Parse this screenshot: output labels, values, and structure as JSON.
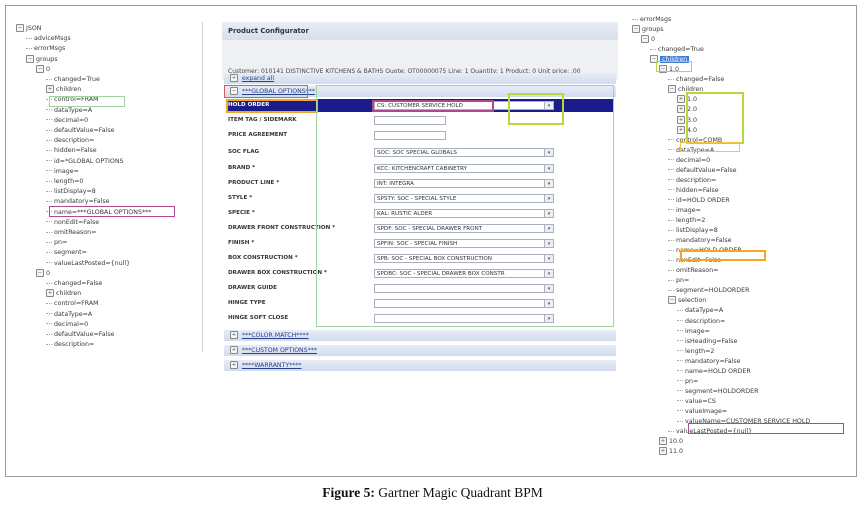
{
  "left_tree": [
    {
      "text": "JSON",
      "indent": 0,
      "toggle": "⊖"
    },
    {
      "text": "adviceMsgs",
      "indent": 1
    },
    {
      "text": "errorMsgs",
      "indent": 1
    },
    {
      "text": "groups",
      "indent": 1,
      "toggle": "⊖"
    },
    {
      "text": "0",
      "indent": 2,
      "toggle": "⊖"
    },
    {
      "text": "changed=True",
      "indent": 3
    },
    {
      "text": "children",
      "indent": 3,
      "toggle": "⊕"
    },
    {
      "text": "control=FRAM",
      "indent": 3
    },
    {
      "text": "dataType=A",
      "indent": 3
    },
    {
      "text": "decimal=0",
      "indent": 3
    },
    {
      "text": "defaultValue=False",
      "indent": 3
    },
    {
      "text": "description=",
      "indent": 3
    },
    {
      "text": "hidden=False",
      "indent": 3
    },
    {
      "text": "id=*GLOBAL OPTIONS",
      "indent": 3
    },
    {
      "text": "image=",
      "indent": 3
    },
    {
      "text": "length=0",
      "indent": 3
    },
    {
      "text": "listDisplay=8",
      "indent": 3
    },
    {
      "text": "mandatory=False",
      "indent": 3
    },
    {
      "text": "name=***GLOBAL OPTIONS***",
      "indent": 3
    },
    {
      "text": "nonEdit=False",
      "indent": 3
    },
    {
      "text": "omitReason=",
      "indent": 3
    },
    {
      "text": "pn=",
      "indent": 3
    },
    {
      "text": "segment=",
      "indent": 3
    },
    {
      "text": "valueLastPosted={null}",
      "indent": 3
    },
    {
      "text": "0",
      "indent": 2,
      "toggle": "⊖"
    },
    {
      "text": "changed=False",
      "indent": 3
    },
    {
      "text": "children",
      "indent": 3,
      "toggle": "⊕"
    },
    {
      "text": "control=FRAM",
      "indent": 3
    },
    {
      "text": "dataType=A",
      "indent": 3
    },
    {
      "text": "decimal=0",
      "indent": 3
    },
    {
      "text": "defaultValue=False",
      "indent": 3
    },
    {
      "text": "description=",
      "indent": 3
    }
  ],
  "right_tree": [
    {
      "text": "errorMsgs",
      "indent": 0
    },
    {
      "text": "groups",
      "indent": 0,
      "toggle": "⊖"
    },
    {
      "text": "0",
      "indent": 1,
      "toggle": "⊖"
    },
    {
      "text": "changed=True",
      "indent": 2
    },
    {
      "text": "children",
      "indent": 2,
      "toggle": "⊖",
      "selected": true
    },
    {
      "text": "1.0",
      "indent": 3,
      "toggle": "⊖"
    },
    {
      "text": "changed=False",
      "indent": 4
    },
    {
      "text": "children",
      "indent": 4,
      "toggle": "⊖"
    },
    {
      "text": "1.0",
      "indent": 5,
      "toggle": "⊕"
    },
    {
      "text": "2.0",
      "indent": 5,
      "toggle": "⊕"
    },
    {
      "text": "3.0",
      "indent": 5,
      "toggle": "⊕"
    },
    {
      "text": "4.0",
      "indent": 5,
      "toggle": "⊕"
    },
    {
      "text": "control=COMB",
      "indent": 4
    },
    {
      "text": "dataType=A",
      "indent": 4
    },
    {
      "text": "decimal=0",
      "indent": 4
    },
    {
      "text": "defaultValue=False",
      "indent": 4
    },
    {
      "text": "description=",
      "indent": 4
    },
    {
      "text": "hidden=False",
      "indent": 4
    },
    {
      "text": "id=HOLD ORDER",
      "indent": 4
    },
    {
      "text": "image=",
      "indent": 4
    },
    {
      "text": "length=2",
      "indent": 4
    },
    {
      "text": "listDisplay=8",
      "indent": 4
    },
    {
      "text": "mandatory=False",
      "indent": 4
    },
    {
      "text": "name=HOLD ORDER",
      "indent": 4
    },
    {
      "text": "nonEdit=False",
      "indent": 4
    },
    {
      "text": "omitReason=",
      "indent": 4
    },
    {
      "text": "pn=",
      "indent": 4
    },
    {
      "text": "segment=HOLDORDER",
      "indent": 4
    },
    {
      "text": "selection",
      "indent": 4,
      "toggle": "⊖"
    },
    {
      "text": "dataType=A",
      "indent": 5
    },
    {
      "text": "description=",
      "indent": 5
    },
    {
      "text": "image=",
      "indent": 5
    },
    {
      "text": "isHeading=False",
      "indent": 5
    },
    {
      "text": "length=2",
      "indent": 5
    },
    {
      "text": "mandatory=False",
      "indent": 5
    },
    {
      "text": "name=HOLD ORDER",
      "indent": 5
    },
    {
      "text": "pn=",
      "indent": 5
    },
    {
      "text": "segment=HOLDORDER",
      "indent": 5
    },
    {
      "text": "value=CS",
      "indent": 5
    },
    {
      "text": "valueImage=",
      "indent": 5
    },
    {
      "text": "valueName=CUSTOMER SERVICE HOLD",
      "indent": 5
    },
    {
      "text": "valueLastPosted={null}",
      "indent": 4
    },
    {
      "text": "10.0",
      "indent": 3,
      "toggle": "⊕"
    },
    {
      "text": "11.0",
      "indent": 3,
      "toggle": "⊕"
    }
  ],
  "configurator": {
    "title": "Product Configurator",
    "info": "Customer:  010141 DISTINCTIVE KITCHENS & BATHS   Quote:  QT00000075   Line:  1  Quantity:  1  Product:  0  Unit price:  .00",
    "expand_all": "expand all",
    "sections": {
      "global": "***GLOBAL OPTIONS***",
      "color": "***COLOR MATCH****",
      "custom": "***CUSTOM OPTIONS***",
      "warranty": "****WARRANTY****"
    },
    "fields": [
      {
        "label": "HOLD ORDER",
        "type": "select",
        "value": "CS: CUSTOMER SERVICE HOLD",
        "highlight": true
      },
      {
        "label": "ITEM TAG / SIDEMARK",
        "type": "input",
        "value": ""
      },
      {
        "label": "PRICE AGREEMENT",
        "type": "input",
        "value": ""
      },
      {
        "label": "SOC FLAG",
        "type": "select",
        "value": "SOC: SOC SPECIAL GLOBALS"
      },
      {
        "label": "BRAND *",
        "type": "select",
        "value": "KCC: KITCHENCRAFT CABINETRY"
      },
      {
        "label": "PRODUCT LINE *",
        "type": "select",
        "value": "INT: INTEGRA"
      },
      {
        "label": "STYLE *",
        "type": "select",
        "value": "SPSTY: SOC - SPECIAL STYLE"
      },
      {
        "label": "SPECIE *",
        "type": "select",
        "value": "KAL: RUSTIC ALDER"
      },
      {
        "label": "DRAWER FRONT CONSTRUCTION *",
        "type": "select",
        "value": "SPDF: SOC - SPECIAL DRAWER FRONT"
      },
      {
        "label": "FINISH *",
        "type": "select",
        "value": "SPFIN: SOC - SPECIAL FINISH"
      },
      {
        "label": "BOX CONSTRUCTION *",
        "type": "select",
        "value": "SPB: SOC - SPECIAL BOX CONSTRUCTION"
      },
      {
        "label": "DRAWER BOX CONSTRUCTION *",
        "type": "select",
        "value": "SPDBC: SOC - SPECIAL DRAWER BOX CONSTR"
      },
      {
        "label": "DRAWER GUIDE",
        "type": "select",
        "value": ""
      },
      {
        "label": "HINGE TYPE",
        "type": "select",
        "value": ""
      },
      {
        "label": "HINGE SOFT CLOSE",
        "type": "select",
        "value": ""
      }
    ]
  },
  "caption": {
    "label": "Figure 5:",
    "text": " Gartner Magic Quadrant BPM"
  },
  "colors": {
    "highlight_orange": "#f5a623",
    "highlight_purple": "#b0488f",
    "highlight_green": "#b6d83a",
    "highlight_red": "#e05a5a",
    "header_blue": "#1b1c8c"
  }
}
